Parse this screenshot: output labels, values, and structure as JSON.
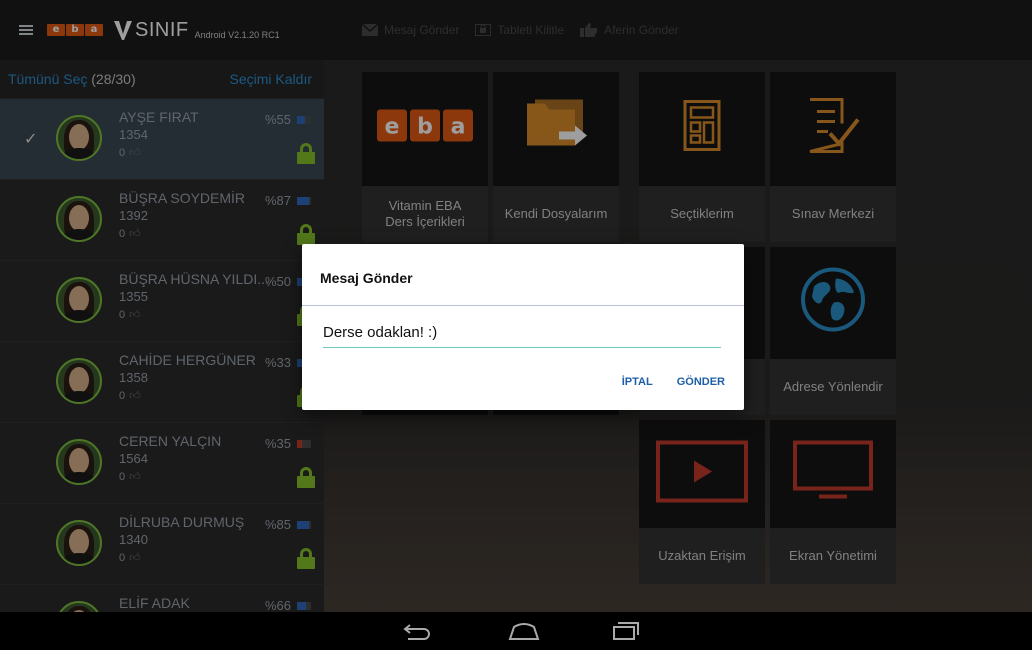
{
  "app": {
    "title": "SINIF",
    "version": "Android V2.1.20 RC1",
    "logo_letters": [
      "e",
      "b",
      "a"
    ]
  },
  "top_actions": [
    {
      "label": "Mesaj Gönder",
      "icon": "mail-icon"
    },
    {
      "label": "Tableti Kilitle",
      "icon": "tablet-lock-icon"
    },
    {
      "label": "Aferin Gönder",
      "icon": "thumbs-up-icon"
    }
  ],
  "sidebar": {
    "select_all": "Tümünü Seç",
    "count": "(28/30)",
    "clear": "Seçimi Kaldır",
    "students": [
      {
        "name": "AYŞE FIRAT",
        "number": "1354",
        "likes": "0",
        "battery": "%55",
        "battery_level": 0.55,
        "battery_color": "#2f6ac0",
        "selected": true
      },
      {
        "name": "BÜŞRA SOYDEMİR",
        "number": "1392",
        "likes": "0",
        "battery": "%87",
        "battery_level": 0.87,
        "battery_color": "#2f6ac0",
        "selected": false
      },
      {
        "name": "BÜŞRA HÜSNA YILDI...",
        "number": "1355",
        "likes": "0",
        "battery": "%50",
        "battery_level": 0.5,
        "battery_color": "#2f6ac0",
        "selected": false
      },
      {
        "name": "CAHİDE HERGÜNER",
        "number": "1358",
        "likes": "0",
        "battery": "%33",
        "battery_level": 0.33,
        "battery_color": "#2f6ac0",
        "selected": false
      },
      {
        "name": "CEREN YALÇIN",
        "number": "1564",
        "likes": "0",
        "battery": "%35",
        "battery_level": 0.35,
        "battery_color": "#c0392b",
        "selected": false
      },
      {
        "name": "DİLRUBA DURMUŞ",
        "number": "1340",
        "likes": "0",
        "battery": "%85",
        "battery_level": 0.85,
        "battery_color": "#2f6ac0",
        "selected": false
      },
      {
        "name": "ELİF ADAK",
        "number": "",
        "likes": "",
        "battery": "%66",
        "battery_level": 0.66,
        "battery_color": "#2f6ac0",
        "selected": false
      }
    ]
  },
  "tiles": [
    {
      "label": "Vitamin EBA\nDers İçerikleri",
      "icon": "eba-logo"
    },
    {
      "label": "Kendi Dosyalarım",
      "icon": "folder-arrow-icon"
    },
    {
      "label": "Seçtiklerim",
      "icon": "layout-icon"
    },
    {
      "label": "Sınav Merkezi",
      "icon": "exam-icon"
    },
    {
      "label": "Adrese Yönlendir",
      "icon": "globe-icon"
    },
    {
      "label": "Uzaktan Erişim",
      "icon": "play-icon"
    },
    {
      "label": "Ekran Yönetimi",
      "icon": "monitor-icon"
    }
  ],
  "dialog": {
    "title": "Mesaj Gönder",
    "message": "Derse odaklan! :)",
    "cancel": "İPTAL",
    "send": "GÖNDER"
  },
  "colors": {
    "accent": "#e25a14",
    "blue": "#2e8fd1",
    "lock_green": "#85c22b",
    "tile_icon": "#d98c2a",
    "tile_icon_red": "#c23a2a"
  }
}
